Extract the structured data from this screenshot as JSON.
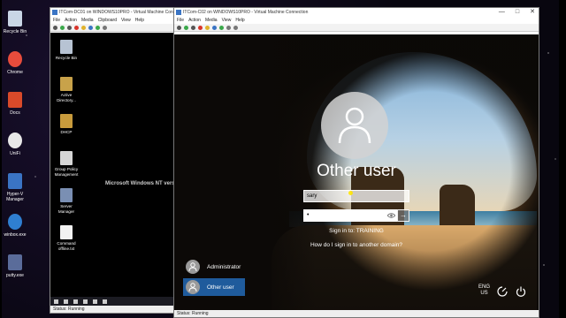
{
  "desktop": {
    "icons": [
      {
        "label": "Recycle Bin",
        "icon": "recycle-bin-icon",
        "color": "#c9d6e6"
      },
      {
        "label": "Chrome",
        "icon": "chrome-icon",
        "color": "#e74c3c"
      },
      {
        "label": "Docs",
        "icon": "docs-icon",
        "color": "#d94a2a"
      },
      {
        "label": "UniFi",
        "icon": "unifi-icon",
        "color": "#e8e8e8"
      },
      {
        "label": "Hyper-V Manager",
        "icon": "hyper-v-icon",
        "color": "#3a74c4"
      },
      {
        "label": "winbox.exe",
        "icon": "winbox-icon",
        "color": "#2f7fd1"
      },
      {
        "label": "putty.exe",
        "icon": "putty-icon",
        "color": "#5a6c9a"
      }
    ]
  },
  "back_window": {
    "title": "ITCom-DC01 on WINDOWS10PRO - Virtual Machine Connection",
    "menu": [
      "File",
      "Action",
      "Media",
      "Clipboard",
      "View",
      "Help"
    ],
    "guest_icons": [
      {
        "label": "Recycle Bin",
        "icon": "recycle-bin-icon",
        "color": "#b7c3d3"
      },
      {
        "label": "Active Directory...",
        "icon": "active-directory-icon",
        "color": "#c8a24a"
      },
      {
        "label": "DHCP",
        "icon": "dhcp-icon",
        "color": "#c89b3c"
      },
      {
        "label": "Group Policy Management",
        "icon": "group-policy-icon",
        "color": "#d6d6d6"
      },
      {
        "label": "Server Manager",
        "icon": "server-manager-icon",
        "color": "#7a8fb3"
      },
      {
        "label": "Command offline.txt",
        "icon": "text-file-icon",
        "color": "#f2f2f2"
      }
    ],
    "overlay_text": "Microsoft Windows NT versi",
    "status": "Status: Running"
  },
  "front_window": {
    "title": "ITCom-C02 on WINDOWS10PRO - Virtual Machine Connection",
    "menu": [
      "File",
      "Action",
      "Media",
      "View",
      "Help"
    ],
    "controls": {
      "minimize": "—",
      "maximize": "□",
      "close": "✕"
    },
    "login": {
      "heading": "Other user",
      "username_value": "sary",
      "password_value": "•",
      "submit_glyph": "→",
      "sign_in_to": "Sign in to: TRAINING",
      "domain_link": "How do I sign in to another domain?"
    },
    "users": [
      {
        "name": "Administrator",
        "selected": false
      },
      {
        "name": "Other user",
        "selected": true
      }
    ],
    "language": {
      "line1": "ENG",
      "line2": "US"
    },
    "status": "Status: Running"
  },
  "colors": {
    "selection_blue": "#1f5b9c",
    "toolbar_red": "#d9342b",
    "toolbar_green": "#3aa84a",
    "toolbar_yellow": "#e0b22b"
  }
}
